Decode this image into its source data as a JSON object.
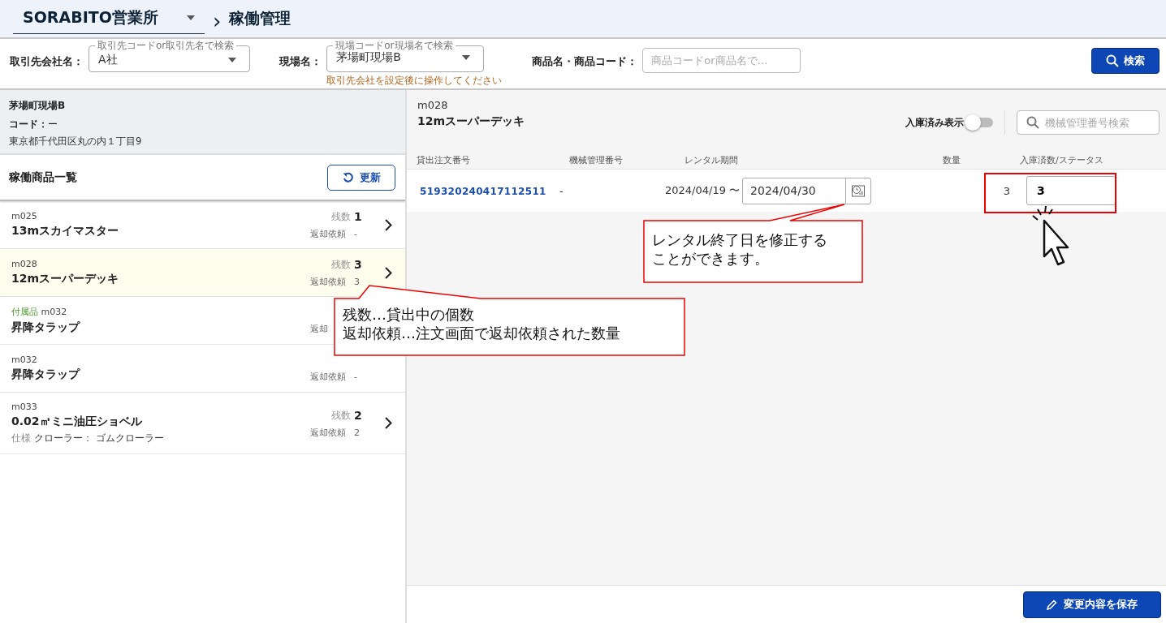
{
  "header": {
    "office": "SORABITO営業所",
    "breadcrumb_sep": "›",
    "page_title": "稼働管理"
  },
  "filters": {
    "customer_label": "取引先会社名：",
    "customer_float": "取引先コードor取引先名で検索",
    "customer_value": "A社",
    "site_label": "現場名：",
    "site_float": "現場コードor現場名で検索",
    "site_value": "茅場町現場B",
    "site_hint": "取引先会社を設定後に操作してください",
    "product_label": "商品名・商品コード：",
    "product_placeholder": "商品コードor商品名で…",
    "search_button": "検索"
  },
  "site": {
    "name": "茅場町現場B",
    "code_label": "コード：",
    "code_value": "ー",
    "address": "東京都千代田区丸の内１丁目9"
  },
  "list": {
    "title": "稼働商品一覧",
    "refresh_button": "更新",
    "items": [
      {
        "code": "m025",
        "name": "13mスカイマスター",
        "remain_label": "残数",
        "remain_value": "1",
        "return_label": "返却依頼",
        "return_value": "-",
        "chevron": true,
        "selected": false
      },
      {
        "code": "m028",
        "name": "12mスーパーデッキ",
        "remain_label": "残数",
        "remain_value": "3",
        "return_label": "返却依頼",
        "return_value": "3",
        "chevron": true,
        "selected": true
      },
      {
        "tag": "付属品",
        "code": "m032",
        "name": "昇降タラップ",
        "return_label": "返却",
        "chevron": false,
        "selected": false
      },
      {
        "code": "m032",
        "name": "昇降タラップ",
        "return_label": "返却依頼",
        "return_value": "-",
        "chevron": false,
        "selected": false
      },
      {
        "code": "m033",
        "name": "0.02㎥ミニ油圧ショベル",
        "spec_label": "仕様",
        "spec": "クローラー： ゴムクローラー",
        "remain_label": "残数",
        "remain_value": "2",
        "return_label": "返却依頼",
        "return_value": "2",
        "chevron": true,
        "selected": false
      }
    ]
  },
  "detail": {
    "code": "m028",
    "name": "12mスーパーデッキ",
    "toggle_label": "入庫済み表示",
    "toggle_on": false,
    "machine_search_placeholder": "機械管理番号検索",
    "columns": [
      "貸出注文番号",
      "機械管理番号",
      "レンタル期間",
      "数量",
      "入庫済数/ステータス"
    ],
    "rows": [
      {
        "order": "519320240417112511",
        "machine": "-",
        "start": "2024/04/19 〜",
        "end": "2024/04/30",
        "quantity": "3",
        "status": "3"
      }
    ],
    "save_button": "変更内容を保存"
  },
  "callouts": [
    {
      "lines": [
        "レンタル終了日を修正する",
        "ことができます。"
      ]
    },
    {
      "lines": [
        "残数…貸出中の個数",
        "返却依頼…注文画面で返却依頼された数量"
      ]
    }
  ]
}
